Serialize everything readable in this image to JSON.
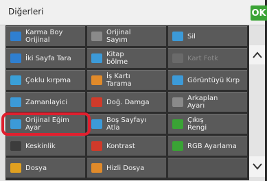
{
  "header": {
    "title": "Diğerleri",
    "ok_label": "OK"
  },
  "scroll": {
    "up_icon": "chevron-up-icon",
    "down_icon": "chevron-down-icon"
  },
  "items": [
    {
      "label": "Karma Boy\nOrijinal",
      "icon": "mixed-size-icon",
      "color": "#2f7fd0",
      "enabled": true
    },
    {
      "label": "Orijinal\nSayım",
      "icon": "count-icon",
      "color": "#8a8a8a",
      "enabled": true
    },
    {
      "label": "Sil",
      "icon": "erase-icon",
      "color": "#3c9ad8",
      "enabled": true
    },
    {
      "label": "İki Sayfa Tara",
      "icon": "two-page-icon",
      "color": "#2f7fd0",
      "enabled": true
    },
    {
      "label": "Kitap\nbölme",
      "icon": "book-icon",
      "color": "#3c9ad8",
      "enabled": true
    },
    {
      "label": "Kart Fotk",
      "icon": "card-icon",
      "color": "#6a6a6a",
      "enabled": false
    },
    {
      "label": "Çoklu kırpma",
      "icon": "multi-crop-icon",
      "color": "#3aa0d8",
      "enabled": true
    },
    {
      "label": "İş Kartı\nTarama",
      "icon": "business-card-icon",
      "color": "#e08a2a",
      "enabled": true
    },
    {
      "label": "Görüntüyü Kırp",
      "icon": "crop-icon",
      "color": "#3c9ad8",
      "enabled": true
    },
    {
      "label": "Zamanlayici",
      "icon": "timer-icon",
      "color": "#3c9ad8",
      "enabled": true
    },
    {
      "label": "Doğ. Damga",
      "icon": "stamp-icon",
      "color": "#d03a2a",
      "enabled": true
    },
    {
      "label": "Arkaplan\nAyarı",
      "icon": "background-icon",
      "color": "#8a8a8a",
      "enabled": true
    },
    {
      "label": "Orijinal Eğim\nAyar",
      "icon": "skew-icon",
      "color": "#3c9ad8",
      "enabled": true
    },
    {
      "label": "Boş Sayfayı\nAtla",
      "icon": "blank-page-icon",
      "color": "#3c9ad8",
      "enabled": true
    },
    {
      "label": "Çıkış\nRengi",
      "icon": "color-output-icon",
      "color": "#3aa335",
      "enabled": true
    },
    {
      "label": "Keskinlik",
      "icon": "sharpness-icon",
      "color": "#3c3c3c",
      "enabled": true
    },
    {
      "label": "Kontrast",
      "icon": "contrast-icon",
      "color": "#d03a2a",
      "enabled": true
    },
    {
      "label": "RGB Ayarlama",
      "icon": "rgb-icon",
      "color": "#3aa335",
      "enabled": true
    },
    {
      "label": "Dosya",
      "icon": "folder-icon",
      "color": "#e0a020",
      "enabled": true
    },
    {
      "label": "Hizli Dosya",
      "icon": "quick-file-icon",
      "color": "#e08a2a",
      "enabled": true
    },
    {
      "label": "",
      "icon": "",
      "color": "",
      "enabled": false
    }
  ]
}
